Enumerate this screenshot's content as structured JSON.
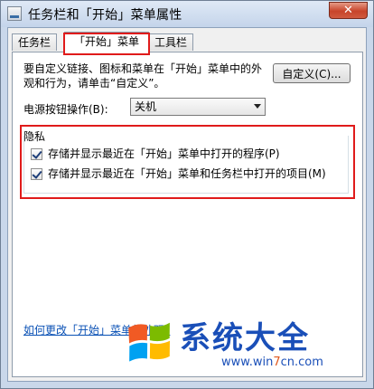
{
  "window": {
    "title": "任务栏和「开始」菜单属性",
    "close_label": "✕"
  },
  "tabs": [
    {
      "label": "任务栏"
    },
    {
      "label": "「开始」菜单"
    },
    {
      "label": "工具栏"
    }
  ],
  "start_menu": {
    "description": "要自定义链接、图标和菜单在「开始」菜单中的外观和行为，请单击“自定义”。",
    "customize_button": "自定义(C)...",
    "power_button_label": "电源按钮操作(B):",
    "power_button_value": "关机",
    "privacy": {
      "label": "隐私",
      "options": [
        {
          "label": "存储并显示最近在「开始」菜单中打开的程序(P)",
          "checked": true
        },
        {
          "label": "存储并显示最近在「开始」菜单和任务栏中打开的项目(M)",
          "checked": true
        }
      ]
    },
    "help_link": "如何更改「开始」菜单的外观?"
  },
  "watermark": {
    "brand": "系统大全",
    "url_prefix": "www.win",
    "url_accent": "7",
    "url_suffix": "cn.com"
  },
  "colors": {
    "highlight": "#e01b1b",
    "link": "#0a51b5",
    "watermark": "#1a4fb8"
  }
}
